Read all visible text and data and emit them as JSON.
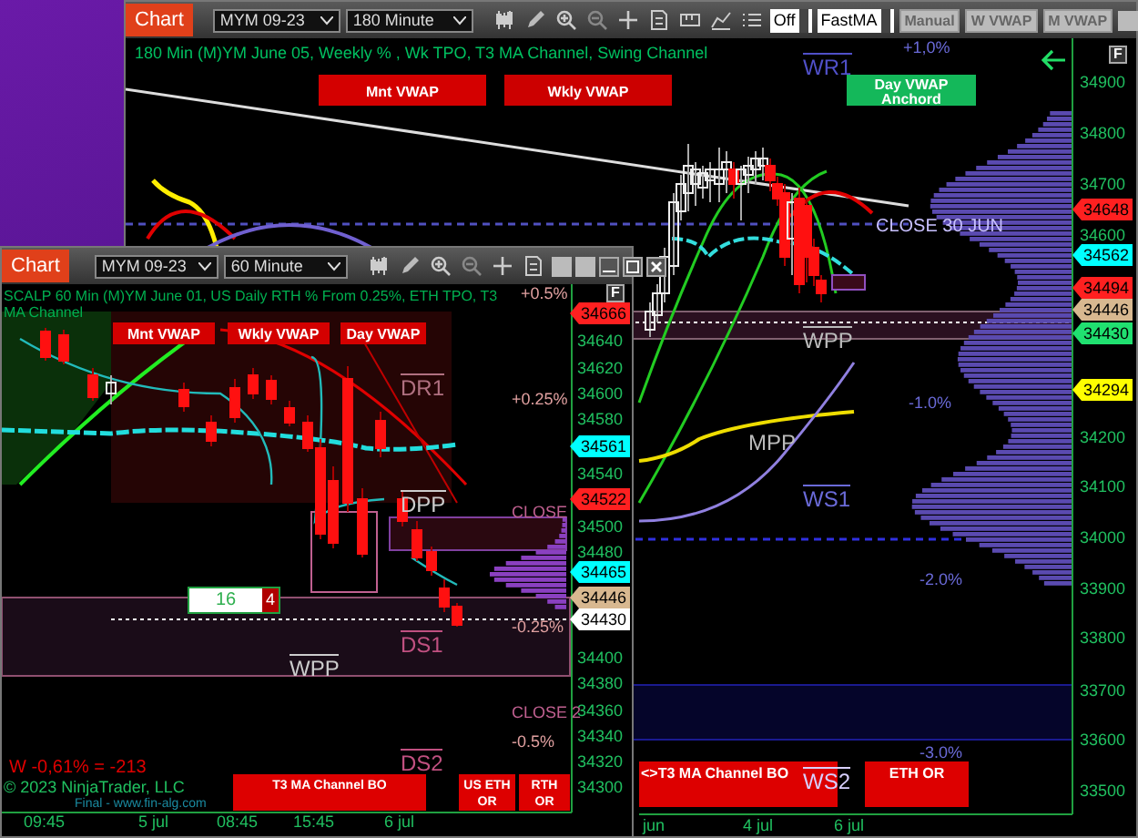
{
  "back_window": {
    "toolbar": {
      "tab": "Chart",
      "instrument": "MYM 09-23",
      "interval": "180 Minute",
      "mode": "Off",
      "indicator": "FastMA",
      "buttons": [
        "Manual",
        "W VWAP",
        "M VWAP"
      ]
    },
    "title": "180 Min (M)YM June 05, Weekly % , Wk TPO, T3 MA Channel, Swing Channel",
    "vwap_buttons": [
      {
        "label": "Mnt VWAP",
        "color": "#d40000"
      },
      {
        "label": "Wkly VWAP",
        "color": "#cc0000"
      },
      {
        "label": "Day VWAP Anchord",
        "color": "#14b85a"
      }
    ],
    "levels": [
      "WR1",
      "+1,0%",
      "CLOSE 30 JUN",
      "WPP",
      "-1.0%",
      "MPP",
      "WS1",
      "-2.0%",
      "-3.0%",
      "WS2"
    ],
    "f_button": "F",
    "price_axis": [
      "34900",
      "34800",
      "34700",
      "34600",
      "34200",
      "34100",
      "34000",
      "33900",
      "33800",
      "33700",
      "33600",
      "33500"
    ],
    "price_tags": [
      {
        "text": "34648",
        "color": "#ff2020"
      },
      {
        "text": "34562",
        "color": "#00ffff"
      },
      {
        "text": "34494",
        "color": "#ff2020"
      },
      {
        "text": "34446",
        "color": "#d8b890"
      },
      {
        "text": "34430",
        "color": "#20e070"
      },
      {
        "text": "34294",
        "color": "#ffff00"
      }
    ],
    "alerts": [
      "<>T3 MA Channel BO",
      "ETH OR"
    ],
    "time_axis": [
      "jun",
      "4 jul",
      "6 jul"
    ]
  },
  "front_window": {
    "toolbar": {
      "tab": "Chart",
      "instrument": "MYM 09-23",
      "interval": "60 Minute"
    },
    "title": "SCALP 60 Min (M)YM June 01, US Daily RTH % From 0.25%, ETH TPO, T3 MA Channel",
    "vwap_buttons": [
      {
        "label": "Mnt VWAP",
        "color": "#d40000"
      },
      {
        "label": "Wkly VWAP",
        "color": "#d40000"
      },
      {
        "label": "Day VWAP",
        "color": "#d40000"
      }
    ],
    "levels": [
      "+0.5%",
      "DR1",
      "+0.25%",
      "DPP",
      "CLOSE",
      "-0.25%",
      "DS1",
      "WPP",
      "CLOSE 2",
      "-0.5%",
      "DS2"
    ],
    "f_button": "F",
    "price_axis": [
      "34640",
      "34620",
      "34600",
      "34580",
      "34540",
      "34500",
      "34480",
      "34400",
      "34380",
      "34360",
      "34340",
      "34320",
      "34300"
    ],
    "price_tags": [
      {
        "text": "34666",
        "color": "#ff2020"
      },
      {
        "text": "34561",
        "color": "#00ffff"
      },
      {
        "text": "34522",
        "color": "#ff2020"
      },
      {
        "text": "34465",
        "color": "#00ffff"
      },
      {
        "text": "34446",
        "color": "#d8b890"
      },
      {
        "text": "34430",
        "color": "#ffffff"
      }
    ],
    "position": {
      "quantity": "16",
      "count": "4"
    },
    "pnl": "W -0,61% = -213",
    "copyright": "© 2023 NinjaTrader, LLC",
    "watermark": "Final - www.fin-alg.com",
    "alerts": [
      "T3 MA Channel BO",
      "US ETH OR",
      "RTH OR"
    ],
    "time_axis": [
      "09:45",
      "5 jul",
      "08:45",
      "15:45",
      "6 jul"
    ]
  }
}
